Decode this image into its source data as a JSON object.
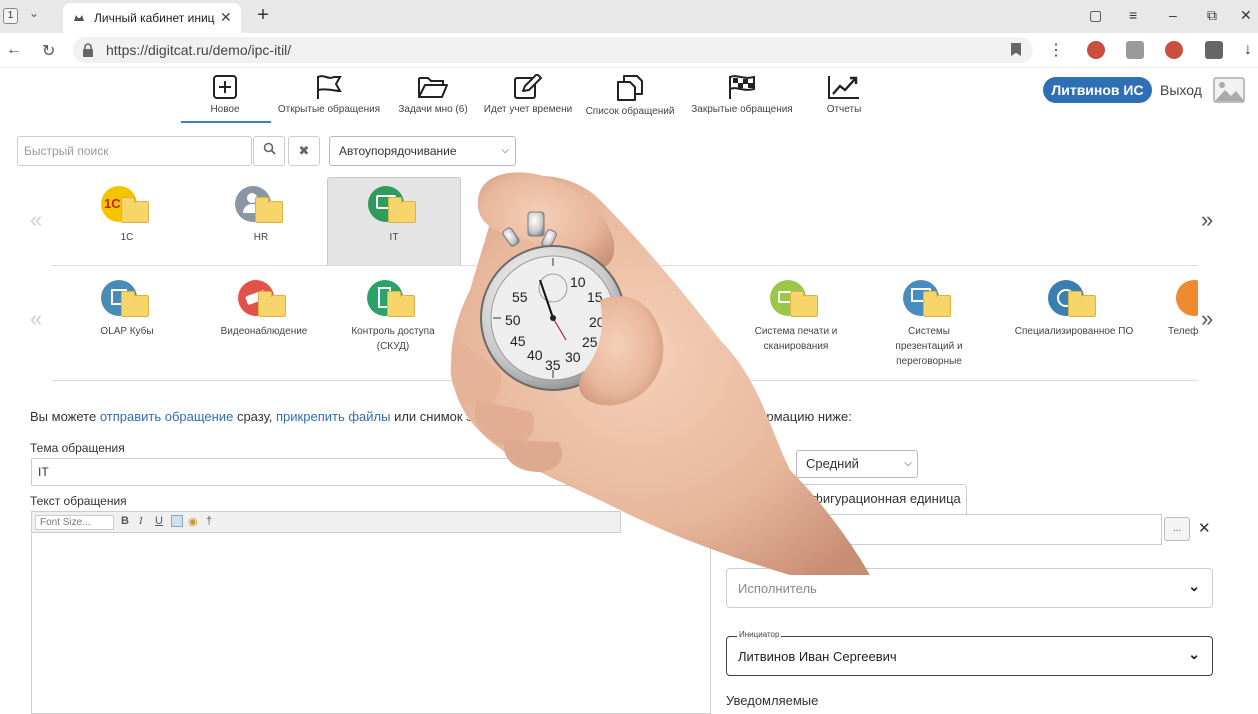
{
  "browser": {
    "tab_count": "1",
    "tab_title": "Личный кабинет иниц",
    "url": "https://digitcat.ru/demo/ipc-itil/"
  },
  "toolbar": {
    "items": [
      {
        "label": "Новое",
        "icon": "plus-square-icon"
      },
      {
        "label": "Открытые обращения",
        "icon": "flag-icon"
      },
      {
        "label": "Задачи мно (6)",
        "icon": "folder-open-icon"
      },
      {
        "label": "Идет учет времени",
        "icon": "edit-icon"
      },
      {
        "label": "Список обращений",
        "icon": "copy-icon"
      },
      {
        "label": "Закрытые обращения",
        "icon": "checkered-flag-icon"
      },
      {
        "label": "Отчеты",
        "icon": "trend-chart-icon"
      }
    ],
    "user_name": "Литвинов ИС",
    "logout": "Выход"
  },
  "search": {
    "placeholder": "Быстрый поиск",
    "sort_value": "Автоупорядочивание"
  },
  "categories_top": [
    {
      "label": "1С",
      "color": "#f5c400"
    },
    {
      "label": "HR",
      "color": "#8a96a6"
    },
    {
      "label": "IT",
      "color": "#2e9c5a",
      "selected": true
    }
  ],
  "categories_sub": [
    {
      "label": "OLAP Кубы",
      "color": "#4d8bb7"
    },
    {
      "label": "Видеонаблюдение",
      "color": "#e0524a"
    },
    {
      "label": "Контроль доступа (СКУД)",
      "color": "#2aa36b"
    },
    {
      "label": "Система печати и сканирования",
      "color": "#9cc64a"
    },
    {
      "label": "Системы презентаций и переговорные",
      "color": "#4a8cc0"
    },
    {
      "label": "Специализированное ПО",
      "color": "#3a7fb0"
    },
    {
      "label": "Телеф",
      "color": "#f08a30"
    }
  ],
  "form": {
    "hint_prefix": "Вы можете",
    "hint_link1": "отправить обращение",
    "hint_mid": "сразу,",
    "hint_link2": "прикрепить файлы",
    "hint_after": "или снимок экра",
    "hint_right": "информацию ниже:",
    "subject_label": "Тема обращения",
    "subject_value": "IT",
    "text_label": "Текст обращения",
    "font_size": "Font Size...",
    "priority_label": "оритет",
    "priority_value": "Средний",
    "config_unit_tab": "Конфигурационная единица",
    "config_dots": "...",
    "assignee_placeholder": "Исполнитель",
    "initiator_label": "Инициатор",
    "initiator_value": "Литвинов Иван Сергеевич",
    "notify_label": "Уведомляемые"
  },
  "colors": {
    "accent": "#2e6fb6",
    "link": "#2e6fb6"
  }
}
